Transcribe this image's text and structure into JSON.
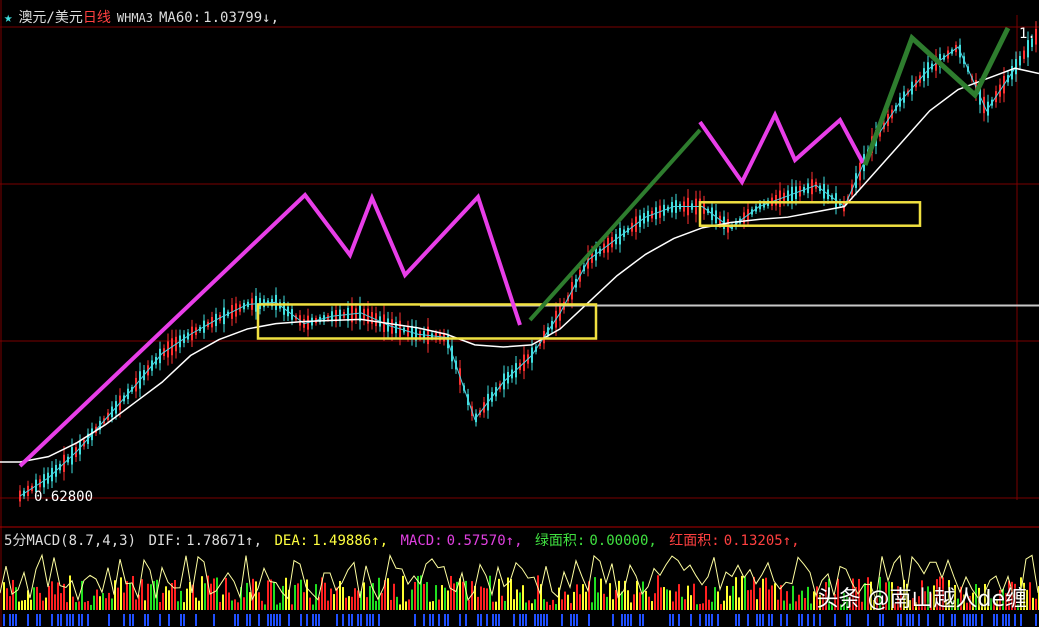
{
  "header": {
    "star": "★",
    "pair": "澳元/美元",
    "period": "日线",
    "indicator": "WHMA3",
    "ma_label": "MA60:",
    "ma_value": "1.03799↓,"
  },
  "price_labels": {
    "low": "0.62800",
    "high": "1."
  },
  "macd_header": {
    "name": "5分MACD(8.7,4,3)",
    "dif_label": "DIF:",
    "dif_value": "1.78671↑,",
    "dea_label": "DEA:",
    "dea_value": "1.49886↑,",
    "macd_label": "MACD:",
    "macd_value": "0.57570↑,",
    "green_label": "绿面积:",
    "green_value": "0.00000,",
    "red_label": "红面积:",
    "red_value": "0.13205↑,"
  },
  "watermark": "头条 @南山越人de缠",
  "colors": {
    "background": "#000000",
    "grid": "#7a0000",
    "ma_line": "#ffffff",
    "zigzag": "#4fd0e0",
    "magenta": "#e83ee8",
    "green_arrow": "#2e7d2e",
    "box": "#f0e040",
    "level_line": "#c8c8c8",
    "candle_up": "#ff3030",
    "candle_down": "#40e0e0"
  },
  "chart_data": {
    "type": "line",
    "ylim": [
      0.628,
      1.08
    ],
    "series": [
      {
        "values": [
          0.628,
          0.645,
          0.67,
          0.7,
          0.73,
          0.762,
          0.78,
          0.795,
          0.808,
          0.81,
          0.79,
          0.797,
          0.8,
          0.788,
          0.78,
          0.777,
          0.7,
          0.735,
          0.76,
          0.8,
          0.85,
          0.87,
          0.89,
          0.9,
          0.9,
          0.88,
          0.9,
          0.91,
          0.92,
          0.9,
          0.96,
          1.0,
          1.03,
          1.05,
          0.99,
          1.03
        ]
      },
      {
        "values": [
          0.66,
          0.665,
          0.678,
          0.695,
          0.715,
          0.735,
          0.76,
          0.775,
          0.785,
          0.79,
          0.792,
          0.793,
          0.794,
          0.79,
          0.786,
          0.78,
          0.77,
          0.768,
          0.77,
          0.785,
          0.81,
          0.835,
          0.855,
          0.87,
          0.88,
          0.885,
          0.888,
          0.89,
          0.895,
          0.9,
          0.93,
          0.96,
          0.99,
          1.01,
          1.02,
          1.03
        ]
      }
    ],
    "boxes": [
      {
        "price_top": 0.808,
        "price_bottom": 0.776
      },
      {
        "price_top": 0.904,
        "price_bottom": 0.882
      }
    ],
    "level_line": 0.807
  }
}
